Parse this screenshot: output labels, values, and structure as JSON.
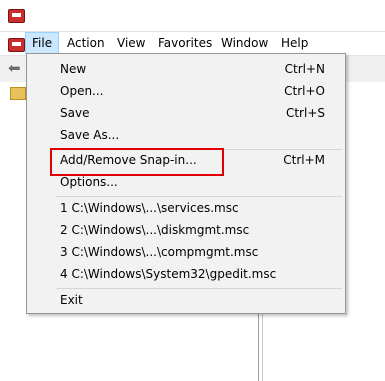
{
  "menubar": {
    "items": [
      "File",
      "Action",
      "View",
      "Favorites",
      "Window",
      "Help"
    ]
  },
  "file_menu": {
    "items": [
      {
        "label": "New",
        "shortcut": "Ctrl+N"
      },
      {
        "label": "Open...",
        "shortcut": "Ctrl+O"
      },
      {
        "label": "Save",
        "shortcut": "Ctrl+S"
      },
      {
        "label": "Save As...",
        "shortcut": ""
      },
      {
        "label": "Add/Remove Snap-in...",
        "shortcut": "Ctrl+M"
      },
      {
        "label": "Options...",
        "shortcut": ""
      },
      {
        "label": "1 C:\\Windows\\...\\services.msc",
        "shortcut": ""
      },
      {
        "label": "2 C:\\Windows\\...\\diskmgmt.msc",
        "shortcut": ""
      },
      {
        "label": "3 C:\\Windows\\...\\compmgmt.msc",
        "shortcut": ""
      },
      {
        "label": "4 C:\\Windows\\System32\\gpedit.msc",
        "shortcut": ""
      },
      {
        "label": "Exit",
        "shortcut": ""
      }
    ],
    "highlighted_item": "Add/Remove Snap-in..."
  },
  "colors": {
    "active_menu_bg": "#cce8ff",
    "highlight_border": "#e00000",
    "app_icon": "#c9302c"
  }
}
